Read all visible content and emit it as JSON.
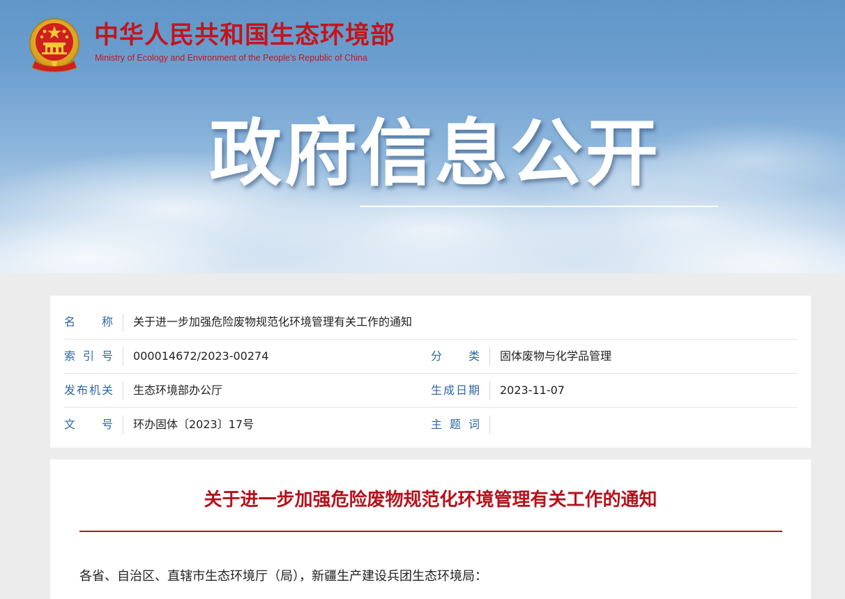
{
  "header": {
    "ministry_cn": "中华人民共和国生态环境部",
    "ministry_en": "Ministry of Ecology and Environment of the People's Republic of China",
    "emblem_icon": "national-emblem-icon"
  },
  "banner": {
    "title": "政府信息公开"
  },
  "metadata": {
    "name_label": "名　　称",
    "name_value": "关于进一步加强危险废物规范化环境管理有关工作的通知",
    "index_label": "索引号",
    "index_value": "000014672/2023-00274",
    "category_label": "分　　类",
    "category_value": "固体废物与化学品管理",
    "issuer_label": "发布机关",
    "issuer_value": "生态环境部办公厅",
    "date_label": "生成日期",
    "date_value": "2023-11-07",
    "doc_no_label": "文　　号",
    "doc_no_value": "环办固体〔2023〕17号",
    "keywords_label": "主题词",
    "keywords_value": ""
  },
  "article": {
    "title": "关于进一步加强危险废物规范化环境管理有关工作的通知",
    "salutation": "各省、自治区、直辖市生态环境厅（局），新疆生产建设兵团生态环境局："
  },
  "colors": {
    "brand_red": "#c4141c",
    "label_blue": "#2d66a6",
    "title_red": "#b5121b"
  }
}
